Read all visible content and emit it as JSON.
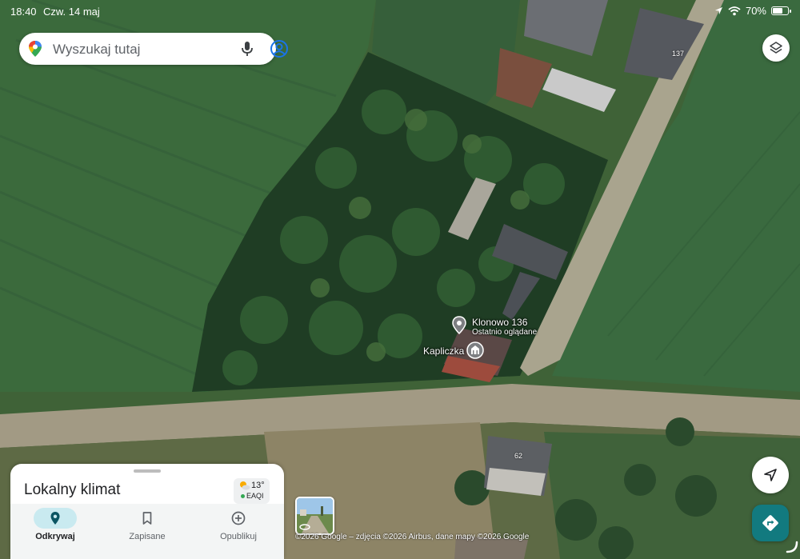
{
  "status_bar": {
    "time": "18:40",
    "date": "Czw. 14 maj",
    "battery": "70%",
    "battery_fraction": 0.7
  },
  "search": {
    "placeholder": "Wyszukaj tutaj"
  },
  "map": {
    "pins": [
      {
        "title": "Klonowo 136",
        "subtitle": "Ostatnio oglądane"
      },
      {
        "title": "Kapliczka"
      }
    ],
    "house_numbers": [
      "137",
      "62"
    ],
    "copyright": "©2026 Google – zdjęcia ©2026 Airbus, dane mapy ©2026 Google"
  },
  "sheet": {
    "title": "Lokalny klimat",
    "weather": {
      "temperature": "13°",
      "index_label": "EAQI"
    },
    "nav": [
      {
        "label": "Odkrywaj",
        "icon": "pin-icon",
        "active": true
      },
      {
        "label": "Zapisane",
        "icon": "bookmark-icon",
        "active": false
      },
      {
        "label": "Opublikuj",
        "icon": "add-circle-icon",
        "active": false
      }
    ]
  }
}
